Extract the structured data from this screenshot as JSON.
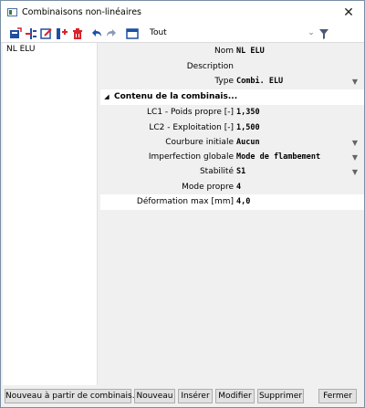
{
  "window": {
    "title": "Combinaisons non-linéaires"
  },
  "toolbar": {
    "all_label": "Tout"
  },
  "list": {
    "items": [
      {
        "label": "NL ELU"
      }
    ]
  },
  "properties": {
    "rows_top": [
      {
        "label": "Nom",
        "value": "NL ELU",
        "dropdown": false
      },
      {
        "label": "Description",
        "value": "",
        "dropdown": false
      },
      {
        "label": "Type",
        "value": "Combi. ELU",
        "dropdown": true
      }
    ],
    "group": {
      "label": "Contenu de la combinais..."
    },
    "rows_bottom": [
      {
        "label": "LC1 - Poids propre [-]",
        "value": "1,350",
        "dropdown": false
      },
      {
        "label": "LC2 - Exploitation [-]",
        "value": "1,500",
        "dropdown": false
      },
      {
        "label": "Courbure initiale",
        "value": "Aucun",
        "dropdown": true
      },
      {
        "label": "Imperfection globale",
        "value": "Mode de flambement",
        "dropdown": true
      },
      {
        "label": "Stabilité",
        "value": "S1",
        "dropdown": true
      },
      {
        "label": "Mode propre",
        "value": "4",
        "dropdown": false
      },
      {
        "label": "Déformation max [mm]",
        "value": "4,0",
        "dropdown": false
      }
    ]
  },
  "buttons": {
    "new_from": "Nouveau à partir de combinais...",
    "new": "Nouveau",
    "insert": "Insérer",
    "modify": "Modifier",
    "delete": "Supprimer",
    "close": "Fermer"
  },
  "colors": {
    "accent_red": "#d9232a",
    "accent_blue": "#1f4fa3",
    "border": "#7a8fa3"
  }
}
